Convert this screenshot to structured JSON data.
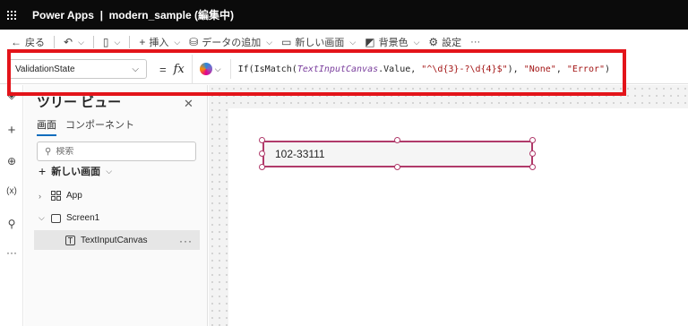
{
  "titlebar": {
    "title": "Power Apps  |  modern_sample (編集中)"
  },
  "commandbar": {
    "back_label": "戻る",
    "insert_label": "挿入",
    "add_data_label": "データの追加",
    "new_screen_label": "新しい画面",
    "background_label": "背景色",
    "settings_label": "設定",
    "more_label": "···"
  },
  "formulabar": {
    "property": "ValidationState",
    "equals": "=",
    "fx": "fx",
    "formula": {
      "part1": "If(IsMatch(",
      "control": "TextInputCanvas",
      "part2": ".Value, ",
      "regex": "\"^\\d{3}-?\\d{4}$\"",
      "part3": "), ",
      "none": "\"None\"",
      "part4": ", ",
      "error": "\"Error\"",
      "part5": ")"
    }
  },
  "highlight_color": "#e3141a",
  "treeview": {
    "title": "ツリー ビュー",
    "tabs": [
      "画面",
      "コンポーネント"
    ],
    "search_placeholder": "検索",
    "new_screen": "新しい画面",
    "nodes": {
      "app": "App",
      "screen": "Screen1",
      "control": "TextInputCanvas"
    },
    "more": "···"
  },
  "canvas": {
    "text_input_value": "102-33111",
    "selection_color": "#b03a6a"
  }
}
